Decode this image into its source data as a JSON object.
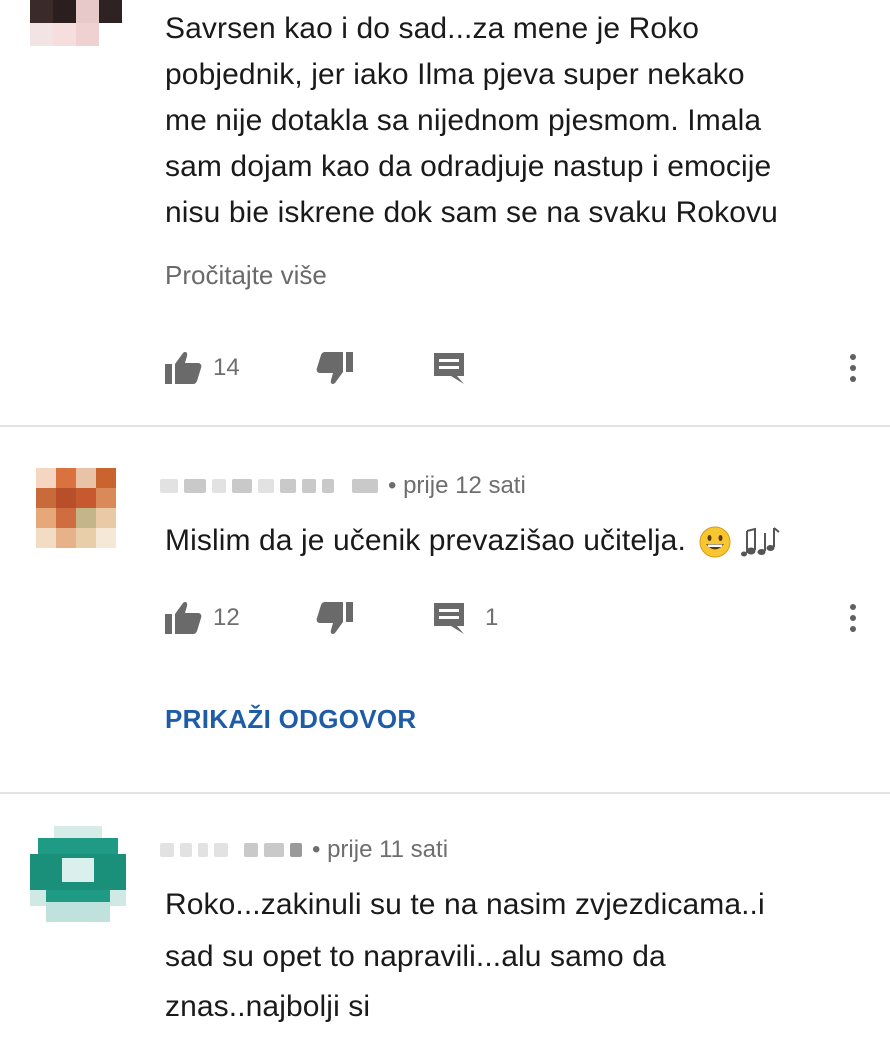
{
  "comments": [
    {
      "text": "Savrsen kao i do sad...za mene je Roko pobjednik,  jer iako Ilma pjeva super nekako me nije dotakla sa nijednom pjesmom. Imala sam dojam kao da odradjuje nastup i emocije nisu bie iskrene dok sam se na svaku Rokovu",
      "lines": [
        "Savrsen kao i do sad...za mene je Roko",
        "pobjednik,  jer iako Ilma pjeva super nekako",
        "me nije dotakla sa nijednom pjesmom. Imala",
        "sam dojam kao da odradjuje nastup i emocije",
        "nisu bie iskrene dok sam se na svaku Rokovu"
      ],
      "read_more": "Pročitajte više",
      "likes": "14",
      "replies": ""
    },
    {
      "time": "• prije 12 sati",
      "text": "Mislim da je učenik prevazišao učitelja.",
      "emoji": [
        "grinning-face-emoji",
        "musical-notes-emoji"
      ],
      "likes": "12",
      "replies": "1",
      "show_replies": "PRIKAŽI ODGOVOR"
    },
    {
      "time": "• prije 11 sati",
      "lines": [
        "Roko...zakinuli su te na nasim zvjezdicama..i",
        "sad su opet to napravili...alu samo da",
        "znas..najbolji si"
      ]
    }
  ],
  "icons": {
    "like": "thumb-up-icon",
    "dislike": "thumb-down-icon",
    "reply": "comment-icon",
    "more": "more-vert-icon"
  },
  "colors": {
    "link": "#1f5ca8",
    "meta": "#6e6e6e",
    "divider": "#e3e3e3"
  }
}
